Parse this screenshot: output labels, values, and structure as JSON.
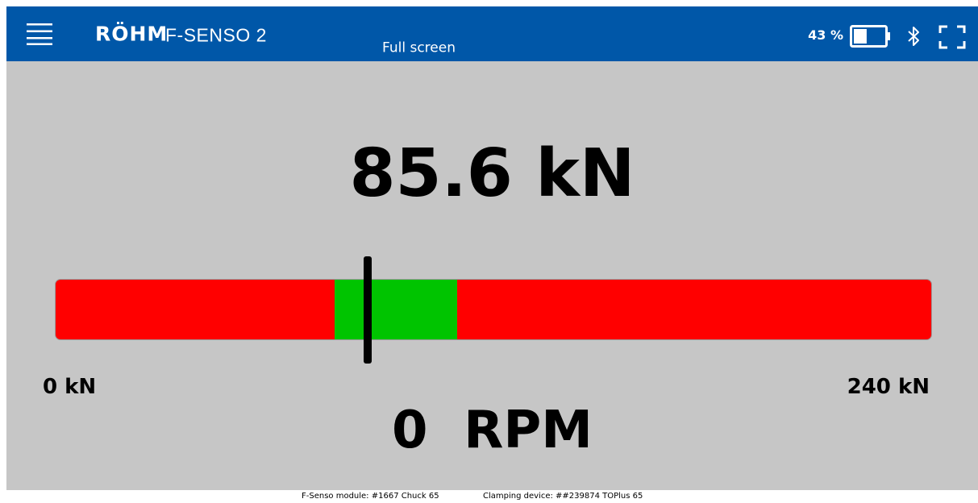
{
  "header": {
    "menu_icon": "hamburger-menu-icon",
    "logo_text": "RÖHM",
    "product_name": "F-SENSO 2",
    "view_label": "Full screen",
    "battery_percent_text": "43 %",
    "battery_level": 0.43,
    "battery_icon": "battery-icon",
    "bluetooth_icon": "bluetooth-icon",
    "fullscreen_icon": "fullscreen-icon",
    "background_color": "#0057a8"
  },
  "main": {
    "force_value": "85.6 kN",
    "gauge": {
      "min": 0,
      "max": 240,
      "ok_range": [
        76.5,
        110
      ],
      "current": 85.6,
      "min_label": "0 kN",
      "max_label": "240 kN",
      "bad_color": "#ff0000",
      "ok_color": "#00c400",
      "marker_color": "#000000"
    },
    "rpm_value": "0  RPM",
    "background_color": "#c6c6c6"
  },
  "footer": {
    "module_text": "F-Senso module: #1667  Chuck 65",
    "device_text": "Clamping device: ##239874  TOPlus 65"
  }
}
